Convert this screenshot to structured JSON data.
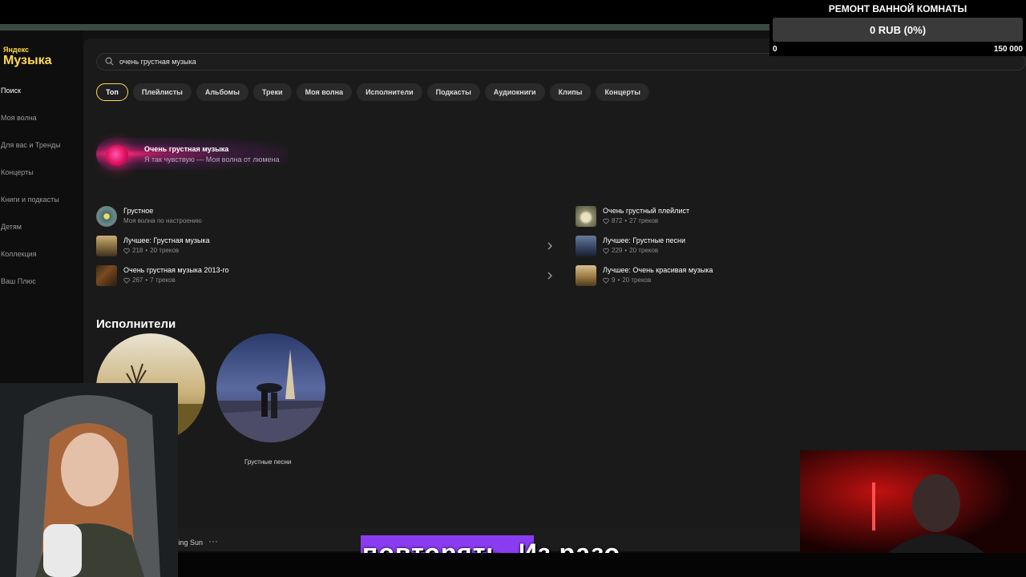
{
  "logo": {
    "small": "Яндекс",
    "big": "Музыка"
  },
  "sidebar": {
    "items": [
      {
        "label": "Поиск",
        "active": true
      },
      {
        "label": "Моя волна",
        "active": false
      },
      {
        "label": "Для вас и Тренды",
        "active": false
      },
      {
        "label": "Концерты",
        "active": false
      },
      {
        "label": "Книги и подкасты",
        "active": false
      },
      {
        "label": "Детям",
        "active": false
      },
      {
        "label": "Коллекция",
        "active": false
      },
      {
        "label": "Ваш Плюс",
        "active": false
      }
    ]
  },
  "search": {
    "value": "очень грустная музыка"
  },
  "filters": [
    "Топ",
    "Плейлисты",
    "Альбомы",
    "Треки",
    "Моя волна",
    "Исполнители",
    "Подкасты",
    "Аудиокниги",
    "Клипы",
    "Концерты"
  ],
  "wave": {
    "title": "Очень грустная музыка",
    "subtitle": "Я так чувствую — Моя волна от люмена"
  },
  "results_left": [
    {
      "title": "Грустное",
      "meta": "Моя волна по настроению",
      "likes": ""
    },
    {
      "title": "Лучшее: Грустная музыка",
      "likes": "218",
      "tracks": "20 треков"
    },
    {
      "title": "Очень грустная музыка 2013-го",
      "likes": "267",
      "tracks": "7 треков"
    }
  ],
  "results_right": [
    {
      "title": "Очень грустный плейлист",
      "likes": "872",
      "tracks": "27 треков"
    },
    {
      "title": "Лучшее: Грустные песни",
      "likes": "229",
      "tracks": "20 треков"
    },
    {
      "title": "Лучшее: Очень красивая музыка",
      "likes": "9",
      "tracks": "20 треков"
    }
  ],
  "artists_section": {
    "title": "Исполнители",
    "items": [
      {
        "label": ""
      },
      {
        "label": "Грустные песни"
      }
    ]
  },
  "player": {
    "track": "sing Sun",
    "more": "···"
  },
  "subtitle": {
    "text": "повторять. Из разо"
  },
  "donation_goal": {
    "title": "РЕМОНТ ВАННОЙ КОМНАТЫ",
    "value": "0 RUB (0%)",
    "progress": 0,
    "min": "0",
    "max": "150 000"
  }
}
